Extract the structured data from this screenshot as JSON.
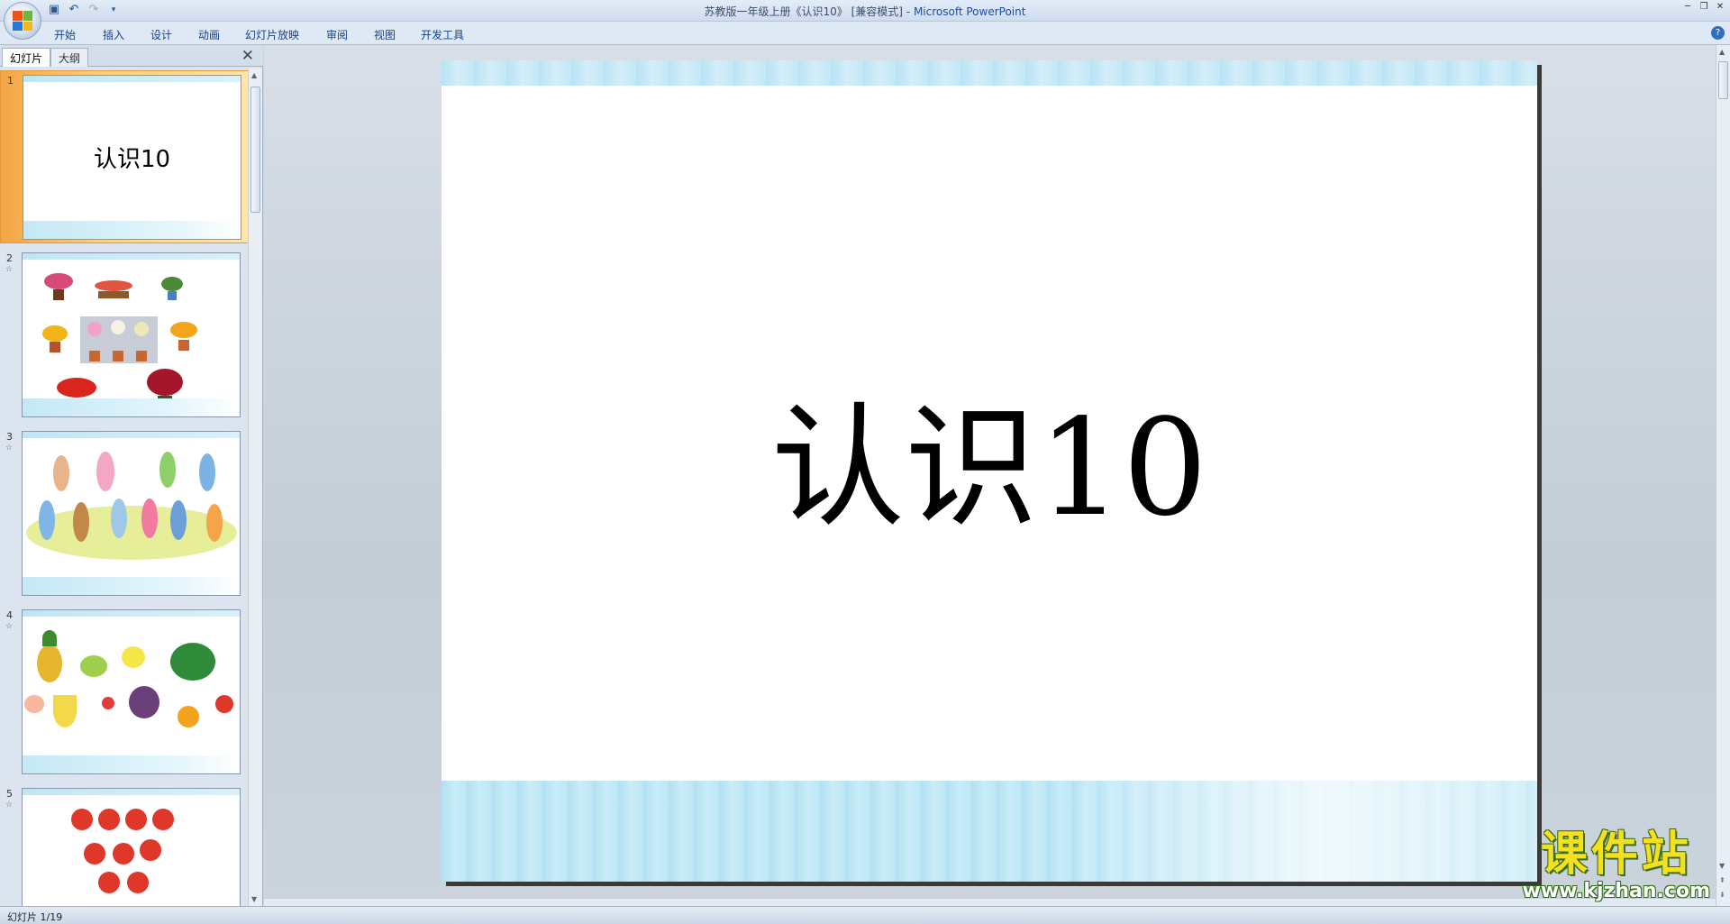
{
  "window": {
    "title_doc": "苏教版一年级上册《认识10》 [兼容模式]",
    "title_sep": " - ",
    "title_app": "Microsoft PowerPoint"
  },
  "ribbon": {
    "tabs": [
      "开始",
      "插入",
      "设计",
      "动画",
      "幻灯片放映",
      "审阅",
      "视图",
      "开发工具"
    ]
  },
  "panel": {
    "tab_slides": "幻灯片",
    "tab_outline": "大纲",
    "thumbnails": [
      {
        "number": "1",
        "title": "认识10"
      },
      {
        "number": "2"
      },
      {
        "number": "3"
      },
      {
        "number": "4"
      },
      {
        "number": "5"
      }
    ]
  },
  "slide": {
    "title": "认识10"
  },
  "status": {
    "slide_counter": "幻灯片 1/19"
  },
  "watermark": {
    "brand": "课件站",
    "url": "www.kjzhan.com"
  },
  "colors": {
    "accent_selected": "#f5a545",
    "slide_band": "#c4e8f6",
    "watermark_yellow": "#f4e020"
  }
}
